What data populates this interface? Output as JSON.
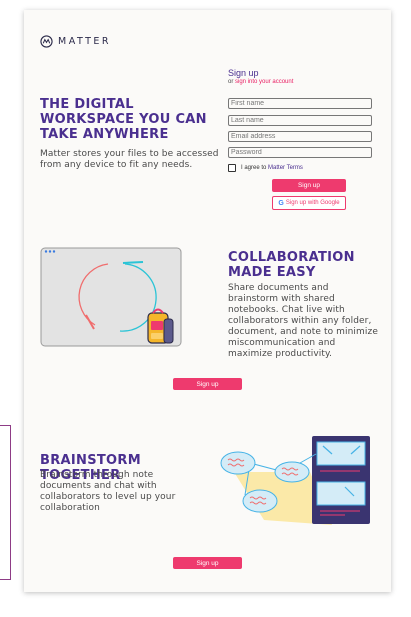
{
  "brand": {
    "name": "MATTER"
  },
  "hero": {
    "title": "THE DIGITAL WORKSPACE YOU CAN TAKE ANYWHERE",
    "description": "Matter stores your files to be accessed from any device to fit any needs."
  },
  "signup_form": {
    "heading": "Sign up",
    "signin_prefix": "or",
    "signin_link": "sign into your account",
    "fields": [
      {
        "placeholder": "First name",
        "value": ""
      },
      {
        "placeholder": "Last name",
        "value": ""
      },
      {
        "placeholder": "Email address",
        "value": ""
      },
      {
        "placeholder": "Password",
        "value": ""
      }
    ],
    "agree_prefix": "I agree to",
    "agree_link": "Matter Terms",
    "agree_checked": false,
    "submit_label": "Sign up",
    "google_label": "Sign up with Google",
    "google_glyph": "G"
  },
  "collaboration": {
    "title": "COLLABORATION MADE EASY",
    "description": "Share documents and brainstorm with shared notebooks. Chat live with collaborators within any folder, document, and note to minimize miscommunication and maximize productivity.",
    "cta_label": "Sign up"
  },
  "brainstorm": {
    "title": "BRAINSTORM TOGETHER",
    "description": "Brainstorm through note documents and chat with collaborators to level up your collaboration",
    "cta_label": "Sign up"
  },
  "colors": {
    "accent_purple": "#4a2f8f",
    "accent_pink": "#ee3a6e",
    "card_bg": "#fbfaf8"
  }
}
